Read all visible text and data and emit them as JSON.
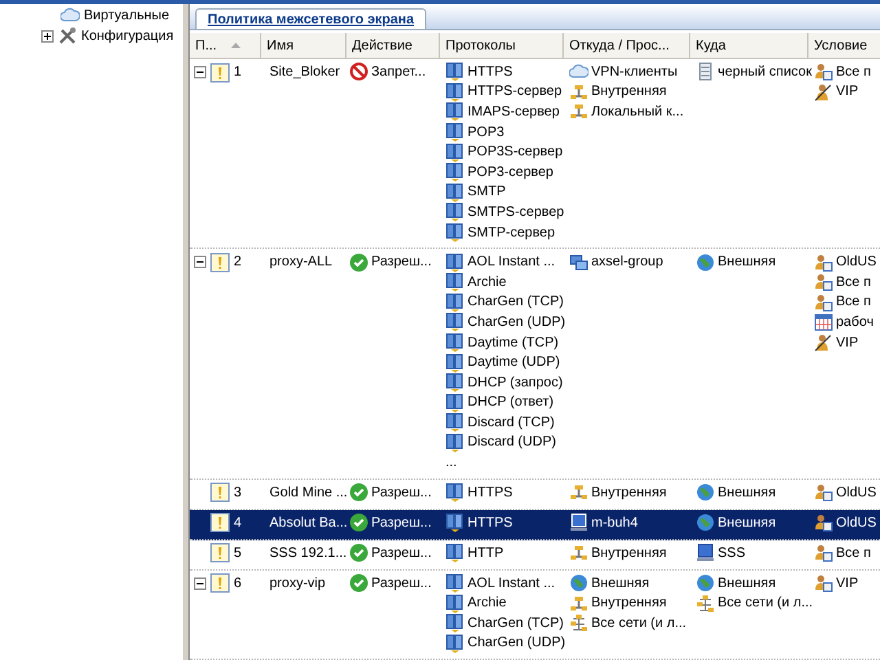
{
  "tree": {
    "items": [
      {
        "label": "Виртуальные",
        "kind": "cloud"
      },
      {
        "label": "Конфигурация",
        "kind": "tools",
        "expanded": false
      }
    ]
  },
  "tabs": [
    {
      "label": "Политика межсетевого экрана",
      "selected": true
    }
  ],
  "table": {
    "columns": [
      "П...",
      "Имя",
      "Действие",
      "Протоколы",
      "Откуда / Прос...",
      "Куда",
      "Условие"
    ],
    "rows": [
      {
        "expanded": true,
        "selected": false,
        "number": "1",
        "name": "Site_Bloker",
        "action": {
          "kind": "deny",
          "text": "Запрет..."
        },
        "protocols": [
          "HTTPS",
          "HTTPS-сервер",
          "IMAPS-сервер",
          "POP3",
          "POP3S-сервер",
          "POP3-сервер",
          "SMTP",
          "SMTPS-сервер",
          "SMTP-сервер"
        ],
        "from": [
          {
            "kind": "vpn",
            "text": "VPN-клиенты"
          },
          {
            "kind": "network",
            "text": "Внутренняя"
          },
          {
            "kind": "network",
            "text": "Локальный к..."
          }
        ],
        "to": [
          {
            "kind": "list",
            "text": "черный список"
          }
        ],
        "conditions": [
          {
            "kind": "users",
            "text": "Все п"
          },
          {
            "kind": "user",
            "text": "VIP"
          }
        ]
      },
      {
        "expanded": true,
        "selected": false,
        "number": "2",
        "name": "proxy-ALL",
        "action": {
          "kind": "allow",
          "text": "Разреш..."
        },
        "protocols": [
          "AOL Instant ...",
          "Archie",
          "CharGen (TCP)",
          "CharGen (UDP)",
          "Daytime (TCP)",
          "Daytime (UDP)",
          "DHCP (запрос)",
          "DHCP (ответ)",
          "Discard (TCP)",
          "Discard (UDP)"
        ],
        "protocols_more": "...",
        "from": [
          {
            "kind": "group",
            "text": "axsel-group"
          }
        ],
        "to": [
          {
            "kind": "globe",
            "text": "Внешняя"
          }
        ],
        "conditions": [
          {
            "kind": "users",
            "text": "OldUS"
          },
          {
            "kind": "users",
            "text": "Все п"
          },
          {
            "kind": "users",
            "text": "Все п"
          },
          {
            "kind": "schedule",
            "text": "рабоч"
          },
          {
            "kind": "user",
            "text": "VIP"
          }
        ]
      },
      {
        "selected": false,
        "number": "3",
        "name": "Gold Mine ...",
        "action": {
          "kind": "allow",
          "text": "Разреш..."
        },
        "protocols": [
          "HTTPS"
        ],
        "from": [
          {
            "kind": "network",
            "text": "Внутренняя"
          }
        ],
        "to": [
          {
            "kind": "globe",
            "text": "Внешняя"
          }
        ],
        "conditions": [
          {
            "kind": "users",
            "text": "OldUS"
          }
        ]
      },
      {
        "selected": true,
        "number": "4",
        "name": "Absolut Ba...",
        "action": {
          "kind": "allow",
          "text": "Разреш..."
        },
        "protocols": [
          "HTTPS"
        ],
        "from": [
          {
            "kind": "computer",
            "text": "m-buh4"
          }
        ],
        "to": [
          {
            "kind": "globe",
            "text": "Внешняя"
          }
        ],
        "conditions": [
          {
            "kind": "users",
            "text": "OldUS"
          }
        ]
      },
      {
        "selected": false,
        "number": "5",
        "name": "SSS 192.1...",
        "action": {
          "kind": "allow",
          "text": "Разреш..."
        },
        "protocols": [
          "HTTP"
        ],
        "from": [
          {
            "kind": "network",
            "text": "Внутренняя"
          }
        ],
        "to": [
          {
            "kind": "computer",
            "text": "SSS"
          }
        ],
        "conditions": [
          {
            "kind": "users",
            "text": "Все п"
          }
        ]
      },
      {
        "expanded": true,
        "selected": false,
        "number": "6",
        "name": "proxy-vip",
        "action": {
          "kind": "allow",
          "text": "Разреш..."
        },
        "protocols": [
          "AOL Instant ...",
          "Archie",
          "CharGen (TCP)",
          "CharGen (UDP)"
        ],
        "from": [
          {
            "kind": "globe",
            "text": "Внешняя"
          },
          {
            "kind": "network",
            "text": "Внутренняя"
          },
          {
            "kind": "networks",
            "text": "Все сети (и л..."
          }
        ],
        "to": [
          {
            "kind": "globe",
            "text": "Внешняя"
          },
          {
            "kind": "networks",
            "text": "Все сети (и л..."
          }
        ],
        "conditions": [
          {
            "kind": "users",
            "text": "VIP"
          }
        ]
      }
    ]
  }
}
